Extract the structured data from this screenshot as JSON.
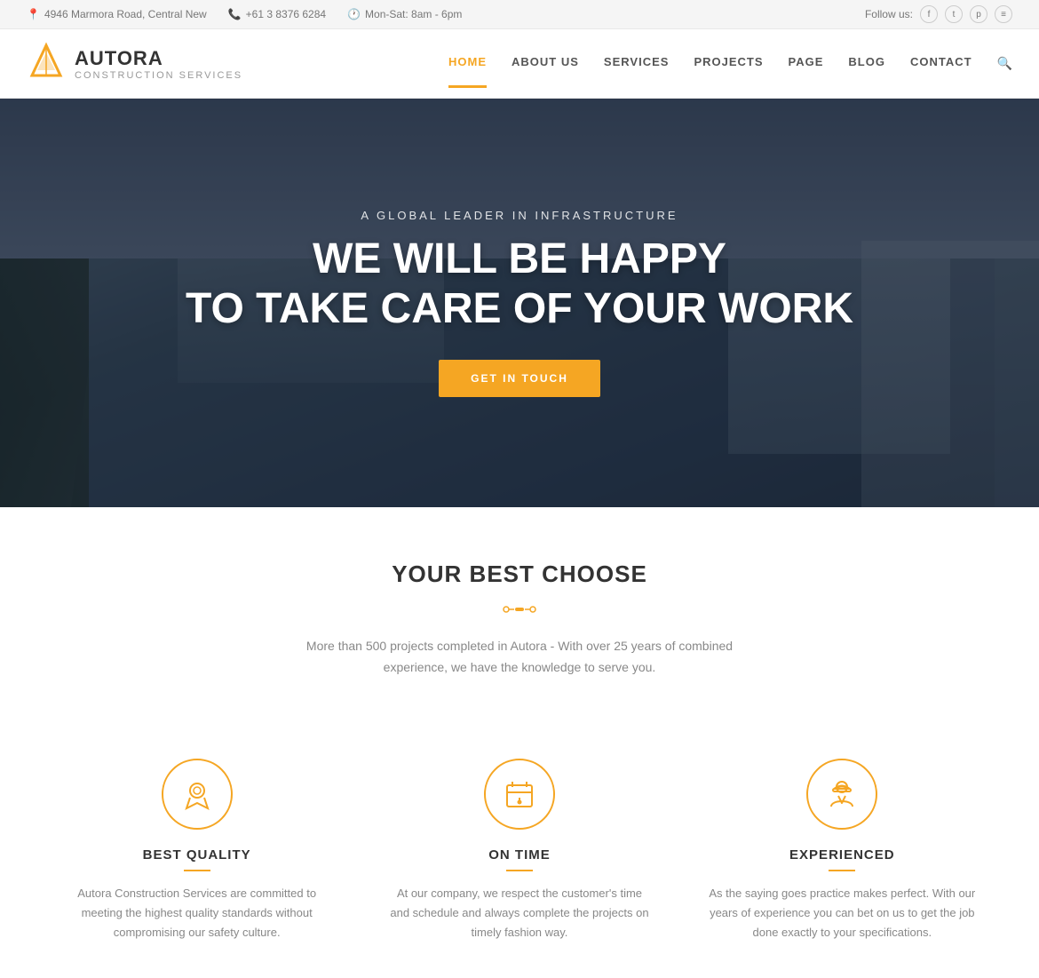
{
  "topbar": {
    "address": "4946 Marmora Road, Central New",
    "phone": "+61 3 8376 6284",
    "hours": "Mon-Sat: 8am - 6pm",
    "follow_label": "Follow us:",
    "socials": [
      "f",
      "t",
      "p",
      "rss"
    ]
  },
  "logo": {
    "name": "AUTORA",
    "subtitle": "Construction services"
  },
  "nav": {
    "items": [
      {
        "label": "HOME",
        "active": true
      },
      {
        "label": "ABOUT US",
        "active": false
      },
      {
        "label": "SERVICES",
        "active": false
      },
      {
        "label": "PROJECTS",
        "active": false
      },
      {
        "label": "PAGE",
        "active": false
      },
      {
        "label": "BLOG",
        "active": false
      },
      {
        "label": "CONTACT",
        "active": false
      }
    ]
  },
  "hero": {
    "subtitle": "A GLOBAL LEADER IN INFRASTRUCTURE",
    "title_line1": "WE WILL BE HAPPY",
    "title_line2": "TO TAKE CARE OF YOUR WORK",
    "cta_label": "GET IN TOUCH"
  },
  "section": {
    "title": "YOUR BEST CHOOSE",
    "description": "More than 500 projects completed in Autora - With over 25 years of combined experience, we have the knowledge to serve you."
  },
  "features": [
    {
      "title": "BEST QUALITY",
      "icon": "🏆",
      "description": "Autora Construction Services are committed to meeting the highest quality standards without compromising our safety culture."
    },
    {
      "title": "ON TIME",
      "icon": "📅",
      "description": "At our company, we respect the customer's time and schedule and always complete the projects on timely fashion way."
    },
    {
      "title": "EXPERIENCED",
      "icon": "👷",
      "description": "As the saying goes practice makes perfect. With our years of experience you can bet on us to get the job done exactly to your specifications."
    }
  ],
  "colors": {
    "accent": "#f5a623",
    "dark": "#333333",
    "light": "#888888"
  }
}
